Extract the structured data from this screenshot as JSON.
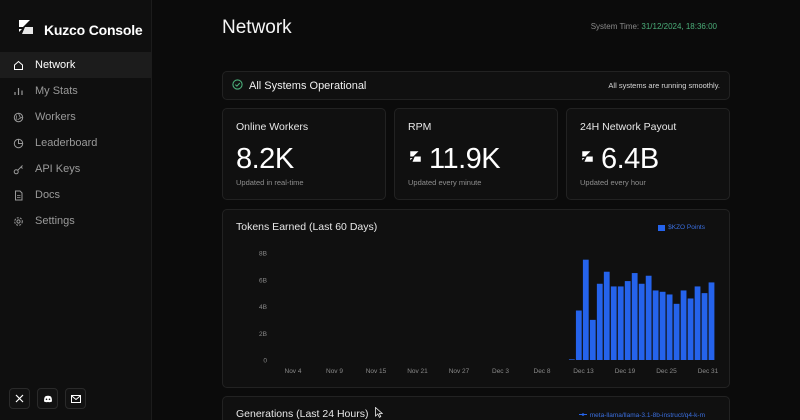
{
  "app": {
    "name": "Kuzco Console"
  },
  "sidebar": {
    "items": [
      {
        "label": "Network",
        "icon": "home-icon",
        "active": true
      },
      {
        "label": "My Stats",
        "icon": "bar-chart-icon",
        "active": false
      },
      {
        "label": "Workers",
        "icon": "aperture-icon",
        "active": false
      },
      {
        "label": "Leaderboard",
        "icon": "pie-chart-icon",
        "active": false
      },
      {
        "label": "API Keys",
        "icon": "key-icon",
        "active": false
      },
      {
        "label": "Docs",
        "icon": "document-icon",
        "active": false
      },
      {
        "label": "Settings",
        "icon": "gear-icon",
        "active": false
      }
    ],
    "socials": [
      "x-icon",
      "discord-icon",
      "mail-icon"
    ]
  },
  "header": {
    "title": "Network",
    "system_time_label": "System Time:",
    "system_time_value": "31/12/2024, 18:36:00"
  },
  "status": {
    "title": "All Systems Operational",
    "message": "All systems are running smoothly."
  },
  "stats": [
    {
      "label": "Online Workers",
      "value": "8.2K",
      "sub": "Updated in real-time",
      "show_logo": false
    },
    {
      "label": "RPM",
      "value": "11.9K",
      "sub": "Updated every minute",
      "show_logo": true
    },
    {
      "label": "24H Network Payout",
      "value": "6.4B",
      "sub": "Updated every hour",
      "show_logo": true
    }
  ],
  "colors": {
    "accent": "#2563eb",
    "status_green": "#4caf7a"
  },
  "chart_data": {
    "type": "bar",
    "title": "Tokens Earned (Last 60 Days)",
    "legend": [
      "$KZO Points"
    ],
    "legend_position": "top-right",
    "ylim": [
      0,
      8
    ],
    "yticks": [
      "0",
      "2B",
      "4B",
      "6B",
      "8B"
    ],
    "xticks": [
      "Nov 4",
      "Nov 9",
      "Nov 15",
      "Nov 21",
      "Nov 27",
      "Dec 3",
      "Dec 8",
      "Dec 13",
      "Dec 19",
      "Dec 25",
      "Dec 31"
    ],
    "grid": false,
    "series": [
      {
        "name": "$KZO Points",
        "values": [
          0,
          0,
          0,
          0,
          0,
          0,
          0,
          0,
          0,
          0,
          0,
          0,
          0,
          0,
          0,
          0,
          0,
          0,
          0,
          0,
          0,
          0,
          0,
          0,
          0,
          0,
          0,
          0,
          0,
          0,
          0,
          0,
          0,
          0,
          0,
          0,
          0,
          0,
          0,
          0,
          0,
          0,
          0.05,
          3.7,
          7.5,
          3.0,
          5.7,
          6.6,
          5.5,
          5.5,
          5.9,
          6.5,
          5.7,
          6.3,
          5.2,
          5.1,
          4.9,
          4.2,
          5.2,
          4.6,
          5.5,
          5.0,
          5.8
        ]
      }
    ]
  },
  "generations": {
    "title": "Generations (Last 24 Hours)",
    "model": "meta-llama/llama-3.1-8b-instruct/q4-k-m"
  }
}
